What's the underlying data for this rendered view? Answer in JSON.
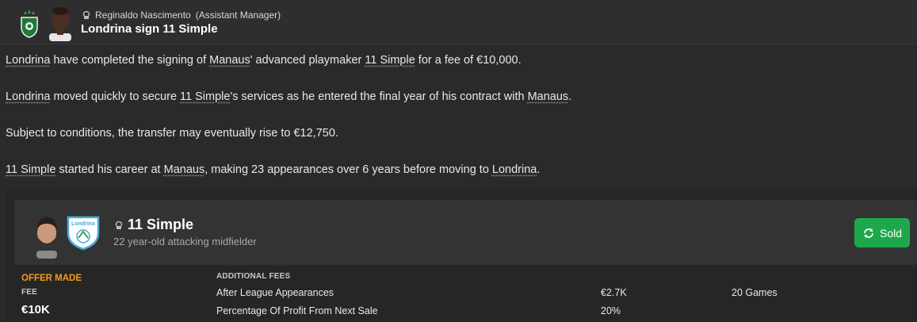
{
  "header": {
    "sender": "Reginaldo Nascimento",
    "sender_role": "(Assistant Manager)",
    "headline": "Londrina sign 11 Simple"
  },
  "article": {
    "p1": [
      {
        "text": "Londrina",
        "link": true
      },
      {
        "text": " have completed the signing of ",
        "link": false
      },
      {
        "text": "Manaus",
        "link": true
      },
      {
        "text": "' advanced playmaker ",
        "link": false
      },
      {
        "text": "11 Simple",
        "link": true
      },
      {
        "text": " for a fee of €10,000.",
        "link": false
      }
    ],
    "p2": [
      {
        "text": "Londrina",
        "link": true
      },
      {
        "text": " moved quickly to secure ",
        "link": false
      },
      {
        "text": "11 Simple",
        "link": true
      },
      {
        "text": "'s services as he entered the final year of his contract with ",
        "link": false
      },
      {
        "text": "Manaus",
        "link": true
      },
      {
        "text": ".",
        "link": false
      }
    ],
    "p3": [
      {
        "text": "Subject to conditions, the transfer may eventually rise to €12,750.",
        "link": false
      }
    ],
    "p4": [
      {
        "text": "11 Simple",
        "link": true
      },
      {
        "text": " started his career at ",
        "link": false
      },
      {
        "text": "Manaus",
        "link": true
      },
      {
        "text": ", making 23 appearances over 6 years before moving to ",
        "link": false
      },
      {
        "text": "Londrina",
        "link": true
      },
      {
        "text": ".",
        "link": false
      }
    ]
  },
  "player_card": {
    "name": "11 Simple",
    "description": "22 year-old attacking midfielder",
    "status_button": "Sold",
    "club_crest_text": "Londrina"
  },
  "offer": {
    "section_label": "OFFER MADE",
    "fee_label": "FEE",
    "fee_value": "€10K",
    "additional_label": "ADDITIONAL FEES",
    "additional_fees": [
      {
        "name": "After League Appearances",
        "amount": "€2.7K",
        "condition": "20 Games"
      },
      {
        "name": "Percentage Of Profit From Next Sale",
        "amount": "20%",
        "condition": ""
      }
    ]
  },
  "colors": {
    "accent_orange": "#f39a1c",
    "sold_green": "#1fa84b",
    "background": "#2a2a2a"
  },
  "icons": {
    "sender": "person-icon",
    "player": "person-icon",
    "sold": "refresh-icon"
  }
}
